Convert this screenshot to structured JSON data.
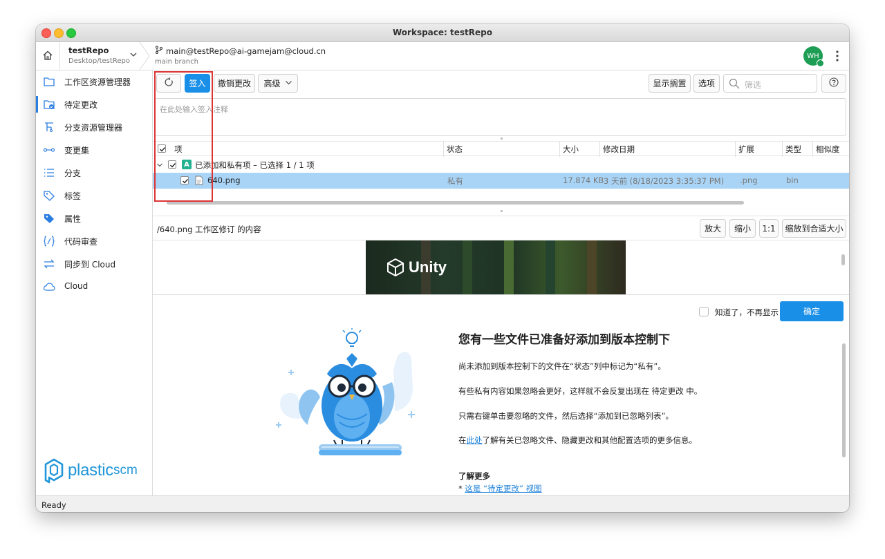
{
  "window": {
    "title": "Workspace: testRepo"
  },
  "header": {
    "repo_name": "testRepo",
    "repo_path": "Desktop/testRepo",
    "branch": "main@testRepo@ai-gamejam@cloud.cn",
    "branch_sub": "main branch",
    "avatar_initials": "WH"
  },
  "sidebar": {
    "items": [
      {
        "label": "工作区资源管理器",
        "icon": "folder-icon"
      },
      {
        "label": "待定更改",
        "icon": "pending-changes-icon",
        "active": true
      },
      {
        "label": "分支资源管理器",
        "icon": "branch-explorer-icon"
      },
      {
        "label": "变更集",
        "icon": "changesets-icon"
      },
      {
        "label": "分支",
        "icon": "list-icon"
      },
      {
        "label": "标签",
        "icon": "tag-icon"
      },
      {
        "label": "属性",
        "icon": "attribute-icon"
      },
      {
        "label": "代码审查",
        "icon": "code-review-icon"
      },
      {
        "label": "同步到 Cloud",
        "icon": "sync-icon"
      },
      {
        "label": "Cloud",
        "icon": "cloud-icon"
      }
    ],
    "logo_main": "plastic",
    "logo_suffix": "scm"
  },
  "toolbar": {
    "checkin_label": "签入",
    "undo_label": "撤销更改",
    "advanced_label": "高级",
    "show_shelves_label": "显示搁置",
    "options_label": "选项",
    "filter_placeholder": "筛选",
    "help_icon": "question-icon"
  },
  "comment": {
    "placeholder": "在此处输入签入注释"
  },
  "table": {
    "columns": [
      "项",
      "状态",
      "大小",
      "修改日期",
      "扩展",
      "类型",
      "相似度"
    ],
    "group": {
      "badge": "A",
      "label": "已添加和私有项 – 已选择 1 / 1 项"
    },
    "rows": [
      {
        "name": "640.png",
        "status": "私有",
        "size": "17.874 KB",
        "date": "3 天前 (8/18/2023 3:35:37 PM)",
        "ext": ".png",
        "type": "bin",
        "similarity": ""
      }
    ]
  },
  "preview": {
    "label": "/640.png 工作区修订 的内容",
    "zoom_in": "放大",
    "zoom_out": "缩小",
    "one_to_one": "1:1",
    "fit": "缩放到合适大小",
    "image_text": "Unity"
  },
  "info": {
    "dismiss_label": "知道了，不再显示",
    "ok_label": "确定",
    "title": "您有一些文件已准备好添加到版本控制下",
    "p1": "尚未添加到版本控制下的文件在“状态”列中标记为“私有”。",
    "p2": "有些私有内容如果忽略会更好，这样就不会反复出现在 待定更改 中。",
    "p3": "只需右键单击要忽略的文件，然后选择“添加到已忽略列表”。",
    "p4_pre": "在",
    "p4_link": "此处",
    "p4_post": "了解有关已忽略文件、隐藏更改和其他配置选项的更多信息。",
    "learn_more": "了解更多",
    "learn_bullet": "*",
    "learn_link": "这是 “待定更改” 视图"
  },
  "status": {
    "text": "Ready"
  },
  "colors": {
    "accent": "#1a8fe8",
    "selected_row": "#a9d4f6",
    "badge_added": "#22b28f",
    "highlight_rect": "#dd3333",
    "logo": "#2196d8"
  }
}
